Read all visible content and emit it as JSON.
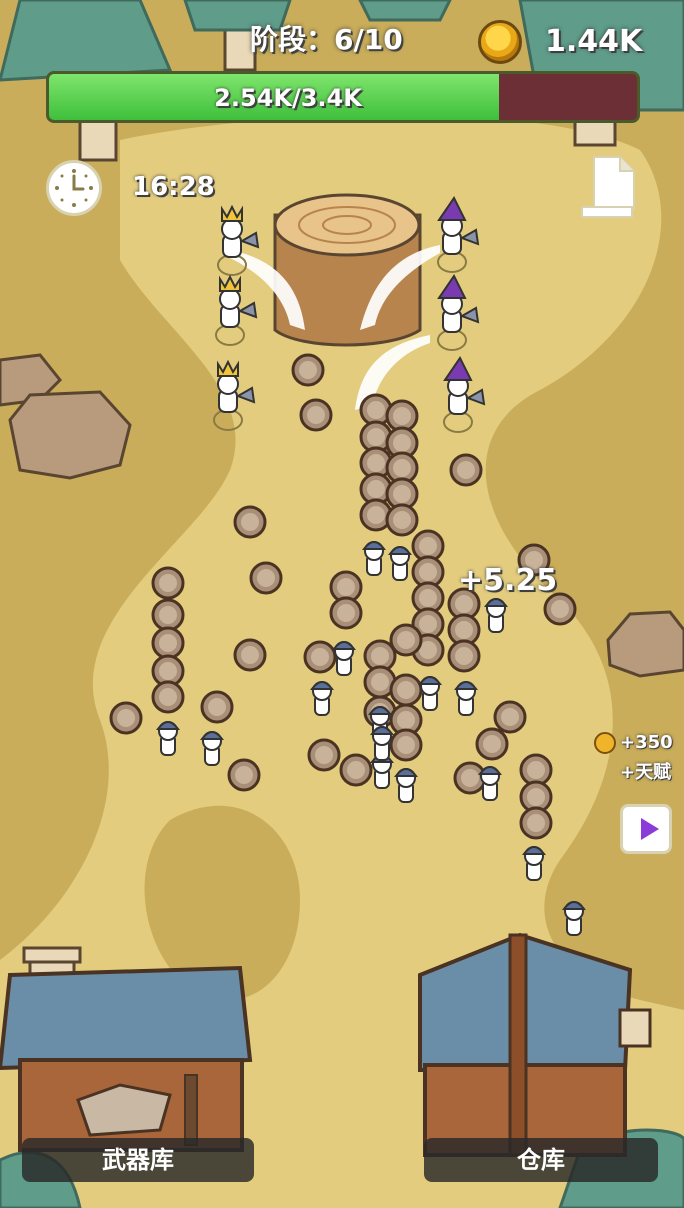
{
  "hud": {
    "stage_label": "阶段：6/10",
    "coins": "1.44K",
    "progress_text": "2.54K/3.4K",
    "progress_fraction": 0.7647,
    "timer": "16:28"
  },
  "floating_gain": "+5.25",
  "reward": {
    "amount": "+350",
    "talent": "+天赋"
  },
  "buildings": {
    "armory_label": "武器库",
    "warehouse_label": "仓库"
  },
  "icons": {
    "coin": "coin-icon",
    "clock": "clock-icon",
    "document": "document-icon",
    "video": "play-video-icon"
  },
  "colors": {
    "progress_fill": "#4cd04a",
    "progress_empty": "#6b2f35",
    "ground": "#c9ad5a",
    "path": "#e3cc7e"
  }
}
